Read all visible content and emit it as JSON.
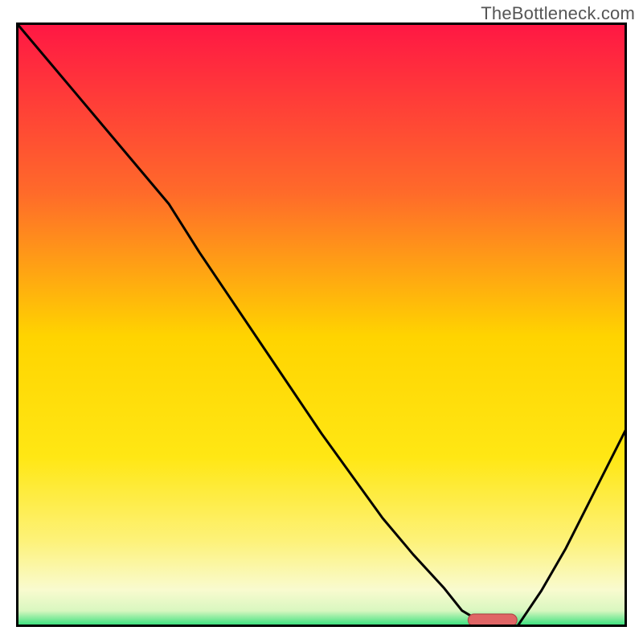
{
  "watermark": "TheBottleneck.com",
  "colors": {
    "border": "#000000",
    "curve": "#000000",
    "marker_fill": "#e06666",
    "marker_stroke": "#b24a4a",
    "gradient_top": "#ff1744",
    "gradient_mid1": "#ff7a2a",
    "gradient_mid2": "#ffd400",
    "gradient_mid3": "#f8f27a",
    "gradient_bottom": "#33e07a",
    "white": "#ffffff"
  },
  "chart_data": {
    "type": "line",
    "title": "",
    "xlabel": "",
    "ylabel": "",
    "xlim": [
      0,
      100
    ],
    "ylim": [
      0,
      100
    ],
    "x": [
      0,
      5,
      10,
      15,
      20,
      25,
      30,
      35,
      40,
      45,
      50,
      55,
      60,
      65,
      70,
      73,
      76,
      79,
      82,
      86,
      90,
      95,
      100
    ],
    "values": [
      100,
      94,
      88,
      82,
      76,
      70,
      62,
      54.5,
      47,
      39.5,
      32,
      25,
      18,
      12,
      6.5,
      2.7,
      0.9,
      0,
      0,
      6,
      13,
      23,
      33
    ],
    "optimum_marker": {
      "x_start": 74,
      "x_end": 82,
      "y": 0
    },
    "annotations": []
  }
}
